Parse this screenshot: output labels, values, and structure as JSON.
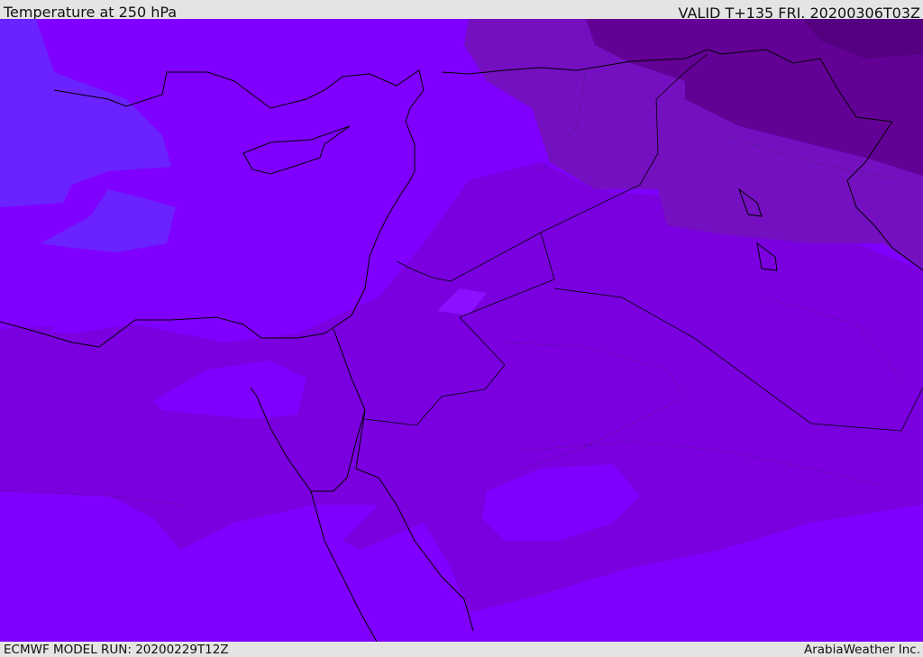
{
  "header": {
    "title": "Temperature at 250 hPa",
    "valid": "VALID T+135 FRI. 20200306T03Z"
  },
  "footer": {
    "model_run": "ECMWF MODEL RUN: 20200229T12Z",
    "credit": "ArabiaWeather Inc."
  },
  "map": {
    "variable": "temperature",
    "level": "250 hPa",
    "colors": {
      "base": "#8000ff",
      "band_darker": "#7a00e0",
      "band_darker2": "#7410c0",
      "band_darkest": "#630096",
      "band_cooler_blue": "#6a22ff",
      "coastline": "#000000"
    }
  }
}
